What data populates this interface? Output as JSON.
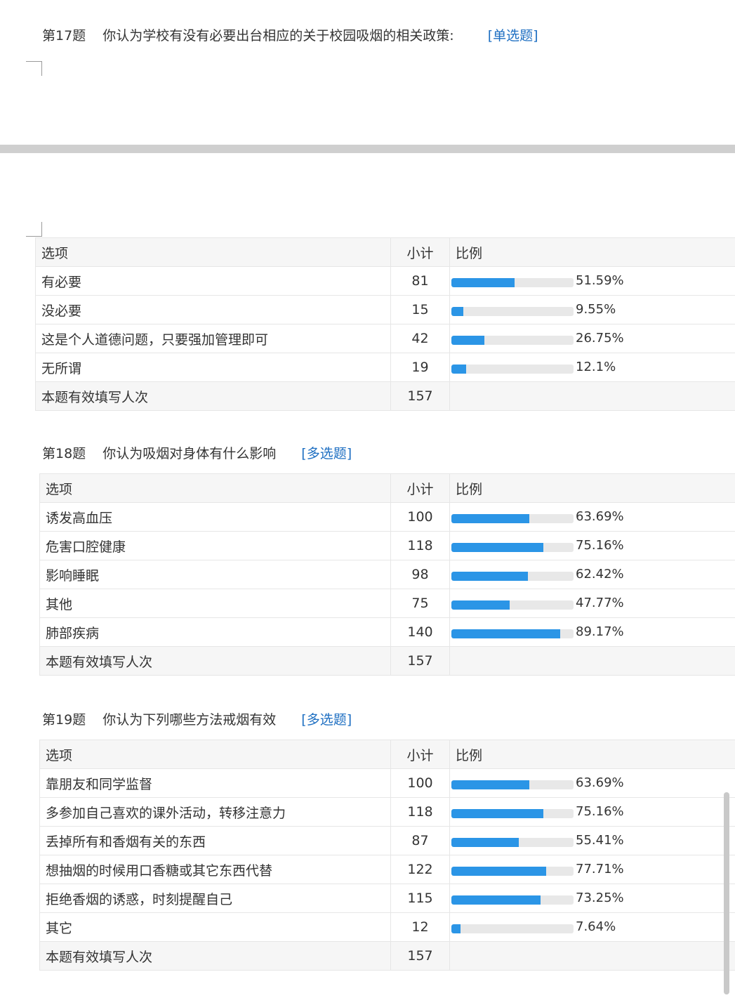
{
  "colors": {
    "accent": "#1e6fc2",
    "bar": "#2b95e6",
    "track": "#e8e8e8",
    "header_bg": "#f6f6f6"
  },
  "headers": {
    "option": "选项",
    "count": "小计",
    "ratio": "比例"
  },
  "questions": [
    {
      "number": "第17题",
      "text": "你认为学校有没有必要出台相应的关于校园吸烟的相关政策:",
      "type": "[单选题]",
      "rows": [
        {
          "label": "有必要",
          "count": "81",
          "pct": "51.59%",
          "fraction": 0.5159
        },
        {
          "label": "没必要",
          "count": "15",
          "pct": "9.55%",
          "fraction": 0.0955
        },
        {
          "label": "这是个人道德问题，只要强加管理即可",
          "count": "42",
          "pct": "26.75%",
          "fraction": 0.2675
        },
        {
          "label": "无所谓",
          "count": "19",
          "pct": "12.1%",
          "fraction": 0.121
        }
      ],
      "total_label": "本题有效填写人次",
      "total": "157"
    },
    {
      "number": "第18题",
      "text": "你认为吸烟对身体有什么影响",
      "type": "[多选题]",
      "rows": [
        {
          "label": "诱发高血压",
          "count": "100",
          "pct": "63.69%",
          "fraction": 0.6369
        },
        {
          "label": "危害口腔健康",
          "count": "118",
          "pct": "75.16%",
          "fraction": 0.7516
        },
        {
          "label": "影响睡眠",
          "count": "98",
          "pct": "62.42%",
          "fraction": 0.6242
        },
        {
          "label": "其他",
          "count": "75",
          "pct": "47.77%",
          "fraction": 0.4777
        },
        {
          "label": "肺部疾病",
          "count": "140",
          "pct": "89.17%",
          "fraction": 0.8917
        }
      ],
      "total_label": "本题有效填写人次",
      "total": "157"
    },
    {
      "number": "第19题",
      "text": "你认为下列哪些方法戒烟有效",
      "type": "[多选题]",
      "rows": [
        {
          "label": "靠朋友和同学监督",
          "count": "100",
          "pct": "63.69%",
          "fraction": 0.6369
        },
        {
          "label": "多参加自己喜欢的课外活动，转移注意力",
          "count": "118",
          "pct": "75.16%",
          "fraction": 0.7516
        },
        {
          "label": " 丢掉所有和香烟有关的东西",
          "count": "87",
          "pct": "55.41%",
          "fraction": 0.5541
        },
        {
          "label": "想抽烟的时候用口香糖或其它东西代替",
          "count": "122",
          "pct": "77.71%",
          "fraction": 0.7771
        },
        {
          "label": "拒绝香烟的诱惑，时刻提醒自己",
          "count": "115",
          "pct": "73.25%",
          "fraction": 0.7325
        },
        {
          "label": "其它",
          "count": "12",
          "pct": "7.64%",
          "fraction": 0.0764
        }
      ],
      "total_label": "本题有效填写人次",
      "total": "157"
    }
  ]
}
